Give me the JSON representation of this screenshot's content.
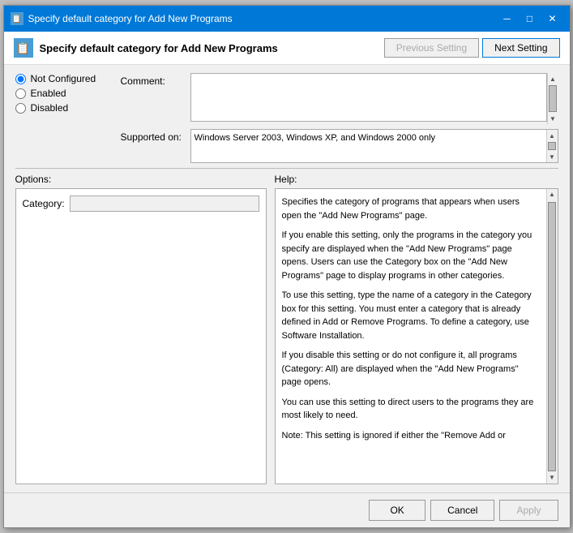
{
  "window": {
    "title": "Specify default category for Add New Programs",
    "icon": "📋"
  },
  "header": {
    "icon": "📋",
    "title": "Specify default category for Add New Programs",
    "prev_button": "Previous Setting",
    "next_button": "Next Setting"
  },
  "radio": {
    "not_configured_label": "Not Configured",
    "enabled_label": "Enabled",
    "disabled_label": "Disabled",
    "selected": "not_configured"
  },
  "comment": {
    "label": "Comment:"
  },
  "supported": {
    "label": "Supported on:",
    "value": "Windows Server 2003, Windows XP, and Windows 2000 only"
  },
  "options": {
    "title": "Options:",
    "category_label": "Category:",
    "category_value": ""
  },
  "help": {
    "title": "Help:",
    "paragraphs": [
      "Specifies the category of programs that appears when users open the \"Add New Programs\" page.",
      "If you enable this setting, only the programs in the category you specify are displayed when the \"Add New Programs\" page opens. Users can use the Category box on the \"Add New Programs\" page to display programs in other categories.",
      "To use this setting, type the name of a category in the Category box for this setting. You must enter a category that is already defined in Add or Remove Programs. To define a category, use Software Installation.",
      "If you disable this setting or do not configure it, all programs (Category: All) are displayed when the \"Add New Programs\" page opens.",
      "You can use this setting to direct users to the programs they are most likely to need.",
      "Note: This setting is ignored if either the \"Remove Add or"
    ]
  },
  "footer": {
    "ok_label": "OK",
    "cancel_label": "Cancel",
    "apply_label": "Apply"
  },
  "title_controls": {
    "minimize": "─",
    "maximize": "□",
    "close": "✕"
  }
}
